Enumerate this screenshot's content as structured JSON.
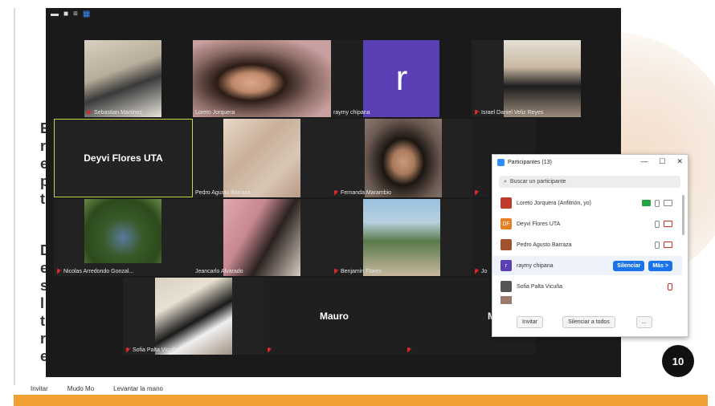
{
  "slide": {
    "page_number": "10",
    "letters_top": [
      "E",
      "r",
      "e",
      "p",
      "t"
    ],
    "letters_bottom": [
      "D",
      "e",
      "s",
      "l",
      "t",
      "r",
      "e"
    ]
  },
  "zoom_bottom_bar": [
    "Invitar",
    "Mudo Mo",
    "Levantar la mano"
  ],
  "tiles": [
    {
      "id": "sebastian",
      "name": "Sebastian Martinez",
      "muted": true
    },
    {
      "id": "loreto",
      "name": "Loreto Jorquera",
      "muted": false
    },
    {
      "id": "raymy",
      "name": "raymy chipana",
      "muted": false,
      "avatar_letter": "r"
    },
    {
      "id": "israel",
      "name": "Israel Daniel Veliz Reyes",
      "muted": true
    },
    {
      "id": "deyvi",
      "name": "Deyvi Flores UTA",
      "muted": false,
      "big_name": "Deyvi Flores UTA"
    },
    {
      "id": "pedro",
      "name": "Pedro Agusto Barraza",
      "muted": false
    },
    {
      "id": "fernanda",
      "name": "Fernanda Marambio",
      "muted": true
    },
    {
      "id": "nicolas",
      "name": "Nicolas Arredondo Gonzal...",
      "muted": true
    },
    {
      "id": "jeancarlo",
      "name": "Jeancarlo Alvarado",
      "muted": false
    },
    {
      "id": "benjamin",
      "name": "Benjamin Flores",
      "muted": true
    },
    {
      "id": "sofia",
      "name": "Sofia Palta Vicuña",
      "muted": true
    },
    {
      "id": "mauro",
      "name": "",
      "muted": false,
      "big_name": "Mauro"
    },
    {
      "id": "matias",
      "name": "",
      "muted": true,
      "big_name": "Matias Roj"
    },
    {
      "id": "partial_j",
      "name": "Jo",
      "muted": true
    },
    {
      "id": "partial_right",
      "name": "",
      "muted": true
    }
  ],
  "participants_panel": {
    "title": "Participantes (13)",
    "search_placeholder": "Buscar un participante",
    "rows": [
      {
        "name": "Loreto Jorquera (Anfitrión, yo)",
        "avatar": "",
        "avatar_color": "#c0392b"
      },
      {
        "name": "Deyvi Flores UTA",
        "avatar": "DF",
        "avatar_color": "#e67e22"
      },
      {
        "name": "Pedro Agusto Barraza",
        "avatar": "",
        "avatar_color": "#a0522d"
      },
      {
        "name": "raymy chipana",
        "avatar": "r",
        "avatar_color": "#5b3fb4"
      },
      {
        "name": "Sofia Palta Vicuña",
        "avatar": "",
        "avatar_color": "#555555"
      }
    ],
    "silence_label": "Silenciar",
    "more_label": "Más >",
    "invite_label": "Invitar",
    "mute_all_label": "Silenciar a todos",
    "more_dots_label": "..."
  },
  "colors": {
    "orange_bar": "#f0a030",
    "zoom_bg": "#1a1a1a",
    "accent_blue": "#1a73e8",
    "raymy_purple": "#5b3fb4"
  }
}
